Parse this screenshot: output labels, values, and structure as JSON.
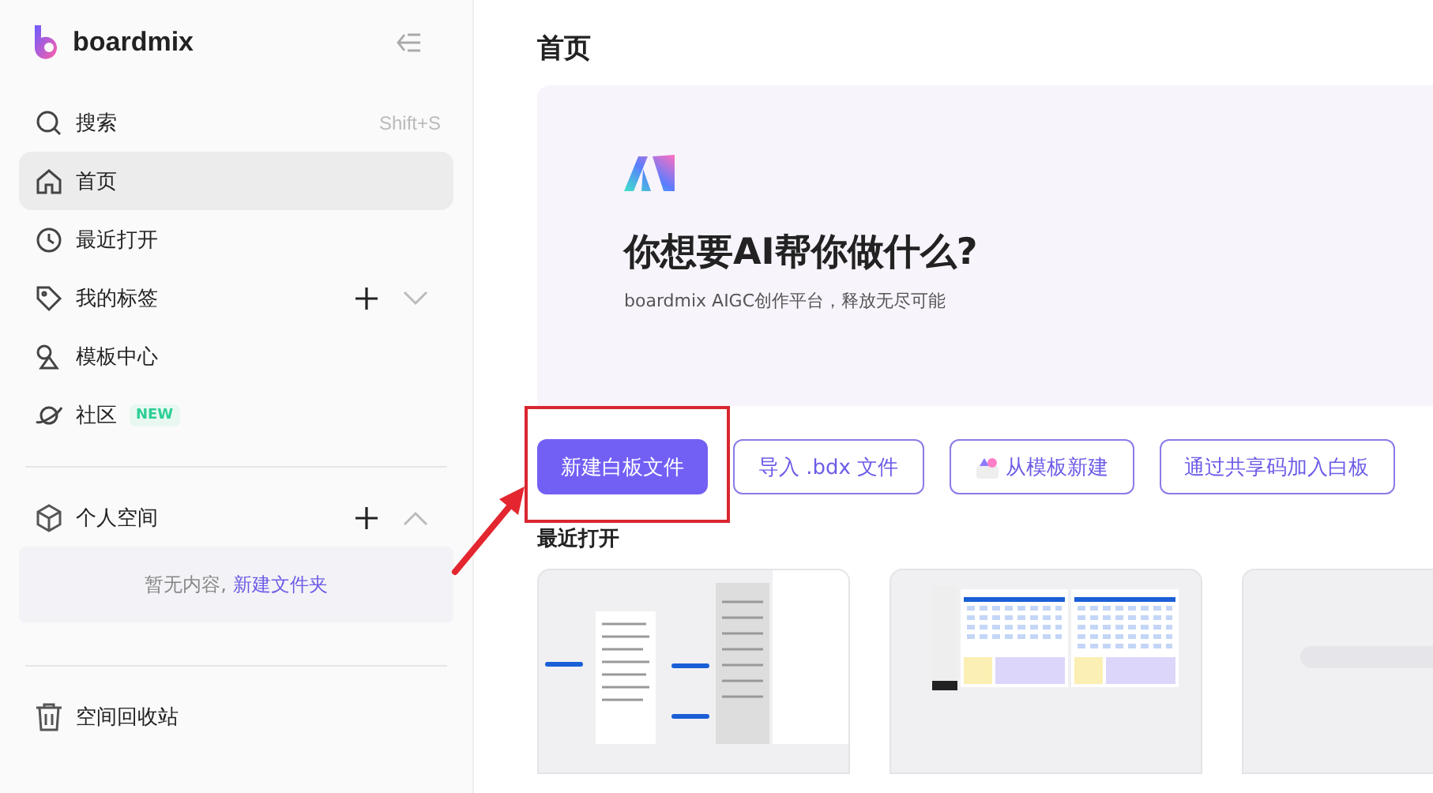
{
  "sidebar": {
    "brand": "boardmix",
    "nav": [
      {
        "label": "搜索",
        "shortcut": "Shift+S",
        "selected": false
      },
      {
        "label": "首页",
        "selected": true
      },
      {
        "label": "最近打开",
        "selected": false
      },
      {
        "label": "我的标签",
        "selected": false,
        "expanded": false
      },
      {
        "label": "模板中心",
        "selected": false
      },
      {
        "label": "社区",
        "selected": false,
        "badge": "NEW"
      }
    ],
    "space": {
      "label": "个人空间",
      "expanded": true,
      "empty_text": "暂无内容,",
      "empty_link": "新建文件夹"
    },
    "trash": {
      "label": "空间回收站"
    }
  },
  "main": {
    "title": "首页",
    "hero": {
      "heading": "你想要AI帮你做什么?",
      "subtitle": "boardmix AIGC创作平台，释放无尽可能"
    },
    "actions": [
      {
        "label": "新建白板文件",
        "kind": "primary",
        "highlighted": true
      },
      {
        "label": "导入 .bdx 文件",
        "kind": "outline",
        "highlighted": false
      },
      {
        "label": "从模板新建",
        "kind": "template",
        "highlighted": false
      },
      {
        "label": "通过共享码加入白板",
        "kind": "outline",
        "highlighted": false
      }
    ],
    "recent": {
      "title": "最近打开",
      "files": [
        {
          "kind": "mindmap"
        },
        {
          "kind": "calendar"
        },
        {
          "kind": "blank"
        }
      ]
    }
  }
}
